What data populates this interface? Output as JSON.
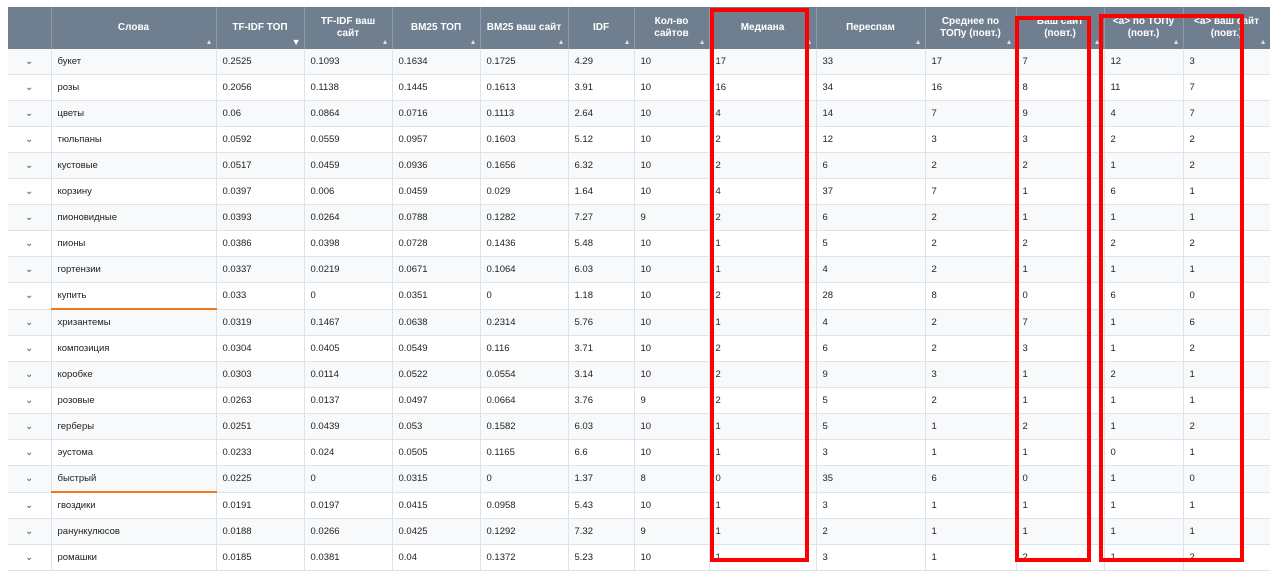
{
  "columns": [
    "",
    "Слова",
    "TF-IDF ТОП",
    "TF-IDF ваш сайт",
    "BM25 ТОП",
    "BM25 ваш сайт",
    "IDF",
    "Кол-во сайтов",
    "Медиана",
    "Переспам",
    "Среднее по ТОПу (повт.)",
    "Ваш сайт (повт.)",
    "<a> по ТОПу (повт.)",
    "<a> ваш сайт (повт.)"
  ],
  "sort_column": "TF-IDF ТОП",
  "rows": [
    [
      "букет",
      "0.2525",
      "0.1093",
      "0.1634",
      "0.1725",
      "4.29",
      "10",
      "17",
      "33",
      "17",
      "7",
      "12",
      "3"
    ],
    [
      "розы",
      "0.2056",
      "0.1138",
      "0.1445",
      "0.1613",
      "3.91",
      "10",
      "16",
      "34",
      "16",
      "8",
      "11",
      "7"
    ],
    [
      "цветы",
      "0.06",
      "0.0864",
      "0.0716",
      "0.1113",
      "2.64",
      "10",
      "4",
      "14",
      "7",
      "9",
      "4",
      "7"
    ],
    [
      "тюльпаны",
      "0.0592",
      "0.0559",
      "0.0957",
      "0.1603",
      "5.12",
      "10",
      "2",
      "12",
      "3",
      "3",
      "2",
      "2"
    ],
    [
      "кустовые",
      "0.0517",
      "0.0459",
      "0.0936",
      "0.1656",
      "6.32",
      "10",
      "2",
      "6",
      "2",
      "2",
      "1",
      "2"
    ],
    [
      "корзину",
      "0.0397",
      "0.006",
      "0.0459",
      "0.029",
      "1.64",
      "10",
      "4",
      "37",
      "7",
      "1",
      "6",
      "1"
    ],
    [
      "пионовидные",
      "0.0393",
      "0.0264",
      "0.0788",
      "0.1282",
      "7.27",
      "9",
      "2",
      "6",
      "2",
      "1",
      "1",
      "1"
    ],
    [
      "пионы",
      "0.0386",
      "0.0398",
      "0.0728",
      "0.1436",
      "5.48",
      "10",
      "1",
      "5",
      "2",
      "2",
      "2",
      "2"
    ],
    [
      "гортензии",
      "0.0337",
      "0.0219",
      "0.0671",
      "0.1064",
      "6.03",
      "10",
      "1",
      "4",
      "2",
      "1",
      "1",
      "1"
    ],
    [
      "купить",
      "0.033",
      "0",
      "0.0351",
      "0",
      "1.18",
      "10",
      "2",
      "28",
      "8",
      "0",
      "6",
      "0"
    ],
    [
      "хризантемы",
      "0.0319",
      "0.1467",
      "0.0638",
      "0.2314",
      "5.76",
      "10",
      "1",
      "4",
      "2",
      "7",
      "1",
      "6"
    ],
    [
      "композиция",
      "0.0304",
      "0.0405",
      "0.0549",
      "0.116",
      "3.71",
      "10",
      "2",
      "6",
      "2",
      "3",
      "1",
      "2"
    ],
    [
      "коробке",
      "0.0303",
      "0.0114",
      "0.0522",
      "0.0554",
      "3.14",
      "10",
      "2",
      "9",
      "3",
      "1",
      "2",
      "1"
    ],
    [
      "розовые",
      "0.0263",
      "0.0137",
      "0.0497",
      "0.0664",
      "3.76",
      "9",
      "2",
      "5",
      "2",
      "1",
      "1",
      "1"
    ],
    [
      "герберы",
      "0.0251",
      "0.0439",
      "0.053",
      "0.1582",
      "6.03",
      "10",
      "1",
      "5",
      "1",
      "2",
      "1",
      "2"
    ],
    [
      "эустома",
      "0.0233",
      "0.024",
      "0.0505",
      "0.1165",
      "6.6",
      "10",
      "1",
      "3",
      "1",
      "1",
      "0",
      "1"
    ],
    [
      "быстрый",
      "0.0225",
      "0",
      "0.0315",
      "0",
      "1.37",
      "8",
      "0",
      "35",
      "6",
      "0",
      "1",
      "0"
    ],
    [
      "гвоздики",
      "0.0191",
      "0.0197",
      "0.0415",
      "0.0958",
      "5.43",
      "10",
      "1",
      "3",
      "1",
      "1",
      "1",
      "1"
    ],
    [
      "ранункулюсов",
      "0.0188",
      "0.0266",
      "0.0425",
      "0.1292",
      "7.32",
      "9",
      "1",
      "2",
      "1",
      "1",
      "1",
      "1"
    ],
    [
      "ромашки",
      "0.0185",
      "0.0381",
      "0.04",
      "0.1372",
      "5.23",
      "10",
      "1",
      "3",
      "1",
      "2",
      "1",
      "2"
    ]
  ],
  "highlighted_rows": [
    "купить",
    "быстрый"
  ],
  "colors": {
    "header_bg": "#6f7f8f",
    "highlight_underline": "#f07a1a",
    "annotation_box": "#ff0000"
  }
}
